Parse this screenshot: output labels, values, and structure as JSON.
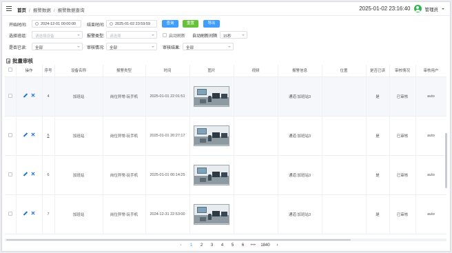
{
  "header": {
    "breadcrumb": [
      "首页",
      "报警数据",
      "报警数据查询"
    ],
    "datetime": "2025-01-02 23:16:40",
    "user": "管理员"
  },
  "filters": {
    "start_label": "开始时间:",
    "start_value": "2024-12-01 00:00:00",
    "end_label": "结束时间:",
    "end_value": "2025-01-02 23:59:59",
    "query_btn": "查询",
    "reset_btn": "重置",
    "export_btn": "导出",
    "device_label": "选择班组:",
    "device_placeholder": "请选择设备",
    "type_label": "报警类型:",
    "type_placeholder": "请选择",
    "auto_refresh_label": "启动刷新",
    "refresh_interval_label": "自动刷新间隔",
    "refresh_interval_value": "15秒",
    "handled_label": "是否已读:",
    "handled_value": "全部",
    "review_status_label": "审核情况:",
    "review_status_value": "全部",
    "review_result_label": "审核结果:",
    "review_result_value": "全部"
  },
  "batch_label": "批量审核",
  "table": {
    "columns": [
      "",
      "操作",
      "序号",
      "设备名称",
      "报警类型",
      "时间",
      "图片",
      "视频",
      "报警信息",
      "位置",
      "是否已读",
      "审核情况",
      "审核用户"
    ],
    "rows": [
      {
        "no": "4",
        "device": "加班站",
        "type": "岗位异常-玩手机",
        "time": "2025-01-01 22:01:51",
        "info": "通道:加班站3",
        "location": "",
        "read": "是",
        "review": "已审核",
        "user": "auto"
      },
      {
        "no": "5",
        "device": "加班站",
        "type": "岗位异常-玩手机",
        "time": "2025-01-01 20:27:17",
        "info": "通道:加班站3",
        "location": "",
        "read": "是",
        "review": "已审核",
        "user": "auto"
      },
      {
        "no": "6",
        "device": "加班站",
        "type": "岗位异常-玩手机",
        "time": "2025-01-01 00:14:25",
        "info": "通道:加班站3",
        "location": "",
        "read": "是",
        "review": "已审核",
        "user": "auto"
      },
      {
        "no": "7",
        "device": "加班站",
        "type": "岗位异常-玩手机",
        "time": "2024-12-31 22:53:00",
        "info": "通道:加班站3",
        "location": "",
        "read": "是",
        "review": "已审核",
        "user": "auto"
      }
    ]
  },
  "pagination": {
    "prev": "‹",
    "pages": [
      "1",
      "2",
      "3",
      "4",
      "5",
      "6"
    ],
    "current": "1",
    "ellipsis": "•••",
    "last": "1840",
    "next": "›"
  }
}
